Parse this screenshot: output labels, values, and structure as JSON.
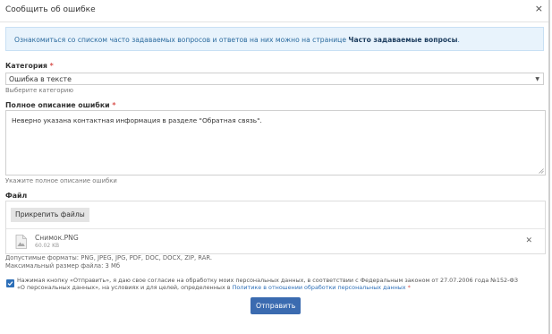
{
  "dialog": {
    "title": "Сообщить об ошибке",
    "close_glyph": "×"
  },
  "info": {
    "text": "Ознакомиться со списком часто задаваемых вопросов и ответов на них можно на странице ",
    "link": "Часто задаваемые вопросы",
    "suffix": "."
  },
  "category": {
    "label": "Категория",
    "required": "*",
    "value": "Ошибка в тексте",
    "hint": "Выберите категорию"
  },
  "description": {
    "label": "Полное описание ошибки",
    "required": "*",
    "value": "Неверно указана контактная информация в разделе \"Обратная связь\".",
    "hint": "Укажите полное описание ошибки"
  },
  "file": {
    "label": "Файл",
    "attach_label": "Прикрепить файлы",
    "item": {
      "name": "Снимок.PNG",
      "size": "60.02 KB"
    },
    "formats": "Допустимые форматы: PNG, JPEG, JPG, PDF, DOC, DOCX, ZIP, RAR.",
    "max_size": "Максимальный размер файла: 3 Мб"
  },
  "consent": {
    "checked": true,
    "text": "Нажимая кнопку «Отправить», я даю свое согласие на обработку моих персональных данных, в соответствии с Федеральным законом от 27.07.2006 года №152-ФЗ «О персональных данных», на условиях и для целей, определенных в ",
    "link": "Политике в отношении обработки персональных данных",
    "required": " *"
  },
  "submit_label": "Отправить",
  "colors": {
    "accent": "#3b6bb0",
    "info_bg": "#e8f3fc",
    "required": "#d9534f"
  },
  "icons": [
    "close-icon",
    "chevron-down-icon",
    "file-image-icon",
    "remove-file-icon",
    "checkmark-icon",
    "resize-grip-icon"
  ]
}
